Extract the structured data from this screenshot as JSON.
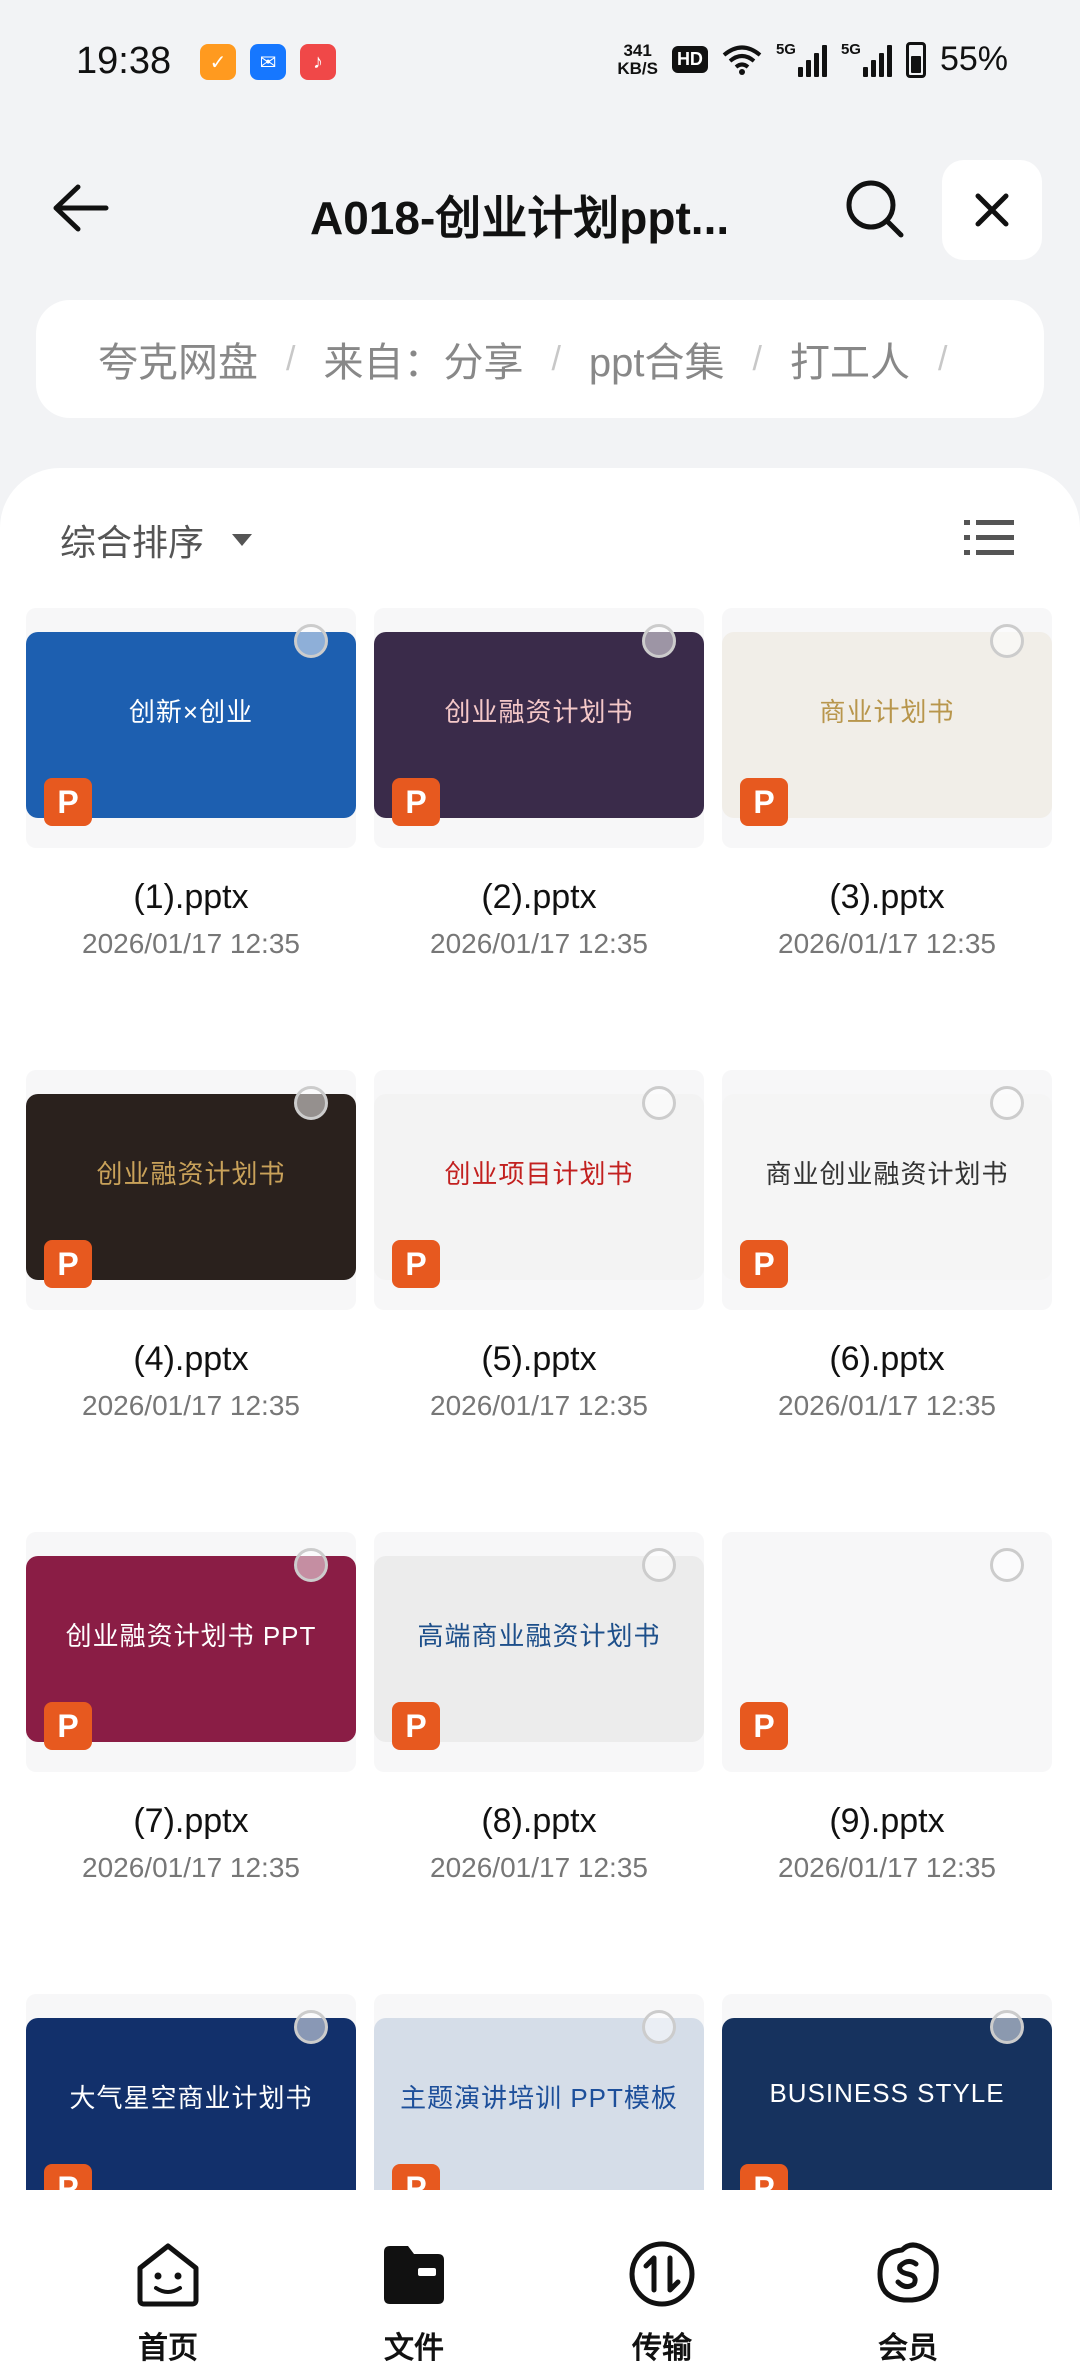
{
  "status_bar": {
    "time": "19:38",
    "net_speed_value": "341",
    "net_speed_unit": "KB/S",
    "hd_badge": "HD",
    "signal1": "5G",
    "signal2": "5G",
    "battery": "55%",
    "battery_level": 0.55
  },
  "header": {
    "title": "A018-创业计划ppt...",
    "back_icon": "back-arrow-icon",
    "search_icon": "search-icon",
    "close_icon": "close-icon"
  },
  "breadcrumb": {
    "items": [
      "夸克网盘",
      "来自：分享",
      "ppt合集",
      "打工人"
    ],
    "separator": "/"
  },
  "toolbar": {
    "sort_label": "综合排序",
    "view_icon": "list-view-icon"
  },
  "files": [
    {
      "name": "(1).pptx",
      "date": "2026/01/17 12:35",
      "thumb_text": "创新×创业",
      "bg": "#1d5fb0",
      "fg": "#ffffff"
    },
    {
      "name": "(2).pptx",
      "date": "2026/01/17 12:35",
      "thumb_text": "创业融资计划书",
      "bg": "#3a2b4a",
      "fg": "#f4c8c8"
    },
    {
      "name": "(3).pptx",
      "date": "2026/01/17 12:35",
      "thumb_text": "商业计划书",
      "bg": "#f1eee8",
      "fg": "#b8964c"
    },
    {
      "name": "(4).pptx",
      "date": "2026/01/17 12:35",
      "thumb_text": "创业融资计划书",
      "bg": "#2a211d",
      "fg": "#c9a25a"
    },
    {
      "name": "(5).pptx",
      "date": "2026/01/17 12:35",
      "thumb_text": "创业项目计划书",
      "bg": "#f3f3f3",
      "fg": "#c2201f"
    },
    {
      "name": "(6).pptx",
      "date": "2026/01/17 12:35",
      "thumb_text": "商业创业融资计划书",
      "bg": "#f5f5f5",
      "fg": "#333333"
    },
    {
      "name": "(7).pptx",
      "date": "2026/01/17 12:35",
      "thumb_text": "创业融资计划书 PPT",
      "bg": "#8a1d45",
      "fg": "#ffffff"
    },
    {
      "name": "(8).pptx",
      "date": "2026/01/17 12:35",
      "thumb_text": "高端商业融资计划书",
      "bg": "#ececec",
      "fg": "#1d4f8a"
    },
    {
      "name": "(9).pptx",
      "date": "2026/01/17 12:35",
      "thumb_text": "",
      "bg": "#f7f7f8",
      "fg": "#999999"
    },
    {
      "name": "",
      "date": "",
      "thumb_text": "大气星空商业计划书",
      "bg": "#12306b",
      "fg": "#ffffff"
    },
    {
      "name": "",
      "date": "",
      "thumb_text": "主题演讲培训 PPT模板",
      "bg": "#d5dde8",
      "fg": "#1d4f9a"
    },
    {
      "name": "",
      "date": "",
      "thumb_text": "BUSINESS STYLE",
      "bg": "#16325e",
      "fg": "#ffffff"
    }
  ],
  "file_badge": "P",
  "bottom_nav": [
    {
      "label": "首页",
      "icon": "home-face-icon"
    },
    {
      "label": "文件",
      "icon": "folder-icon"
    },
    {
      "label": "传输",
      "icon": "transfer-icon"
    },
    {
      "label": "会员",
      "icon": "vip-icon"
    }
  ]
}
